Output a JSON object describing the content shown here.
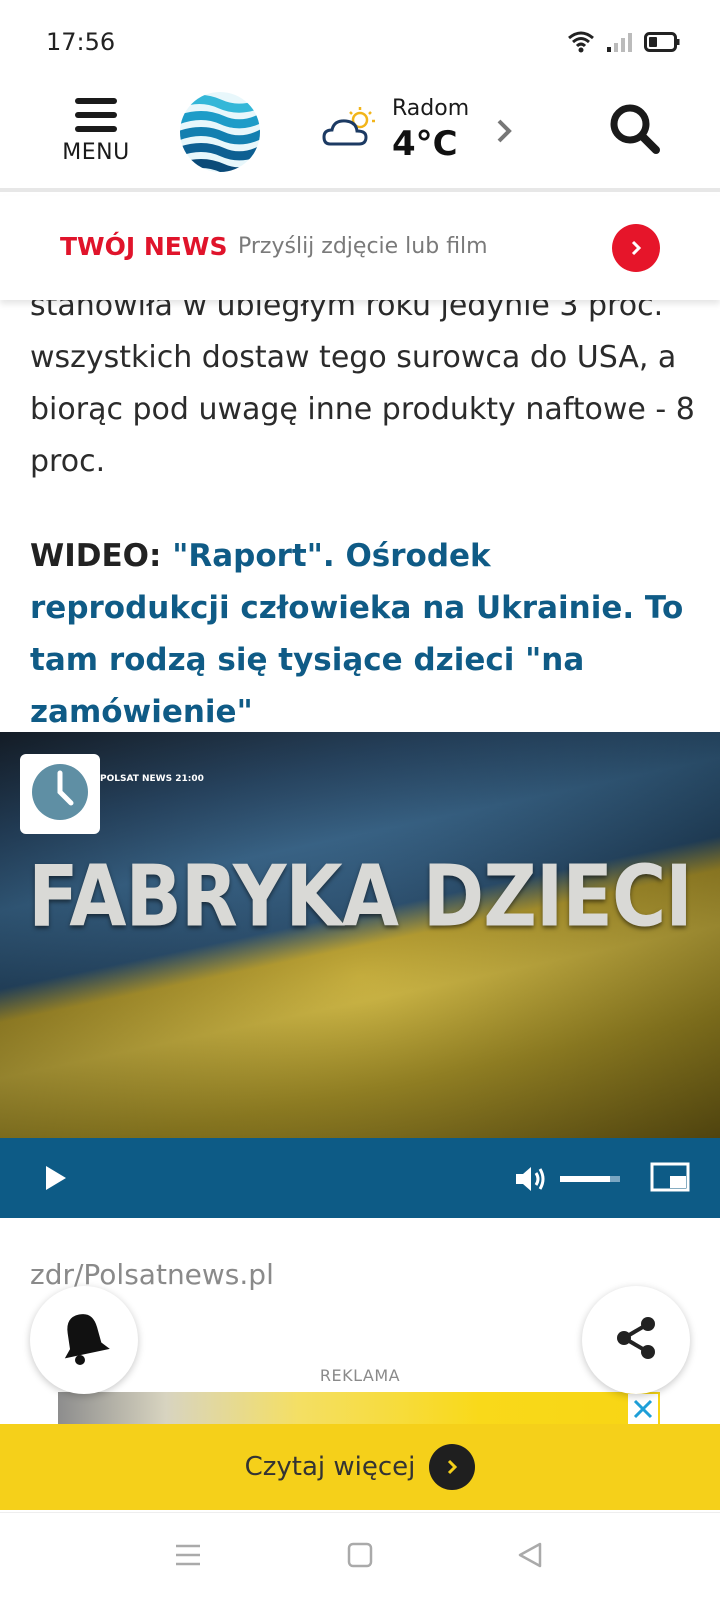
{
  "status_bar": {
    "time": "17:56"
  },
  "header": {
    "menu_label": "MENU",
    "weather_city": "Radom",
    "weather_temp": "4°C"
  },
  "news_banner": {
    "title": "TWÓJ NEWS",
    "subtitle": "Przyślij zdjęcie lub film"
  },
  "article": {
    "paragraph": "stanowiła w ubiegłym roku jedynie 3 proc. wszystkich dostaw tego surowca do USA, a biorąc pod uwagę inne produkty naftowe - 8 proc.",
    "video_prefix": "WIDEO:",
    "video_link": "\"Raport\". Ośrodek reprodukcji człowieka na Ukrainie. To tam rodzą się tysiące dzieci \"na zamówienie\""
  },
  "video": {
    "channel": "POLSAT NEWS 21:00",
    "title": "FABRYKA DZIECI",
    "volume_level": 0.8
  },
  "source": "zdr/Polsatnews.pl",
  "ad": {
    "label": "REKLAMA",
    "read_more": "Czytaj więcej"
  },
  "colors": {
    "brand_blue": "#0d5b86",
    "news_red": "#e0142b",
    "ad_yellow": "#f5d01a"
  },
  "icons": [
    "wifi-icon",
    "signal-icon",
    "battery-icon",
    "menu-icon",
    "logo-icon",
    "partly-cloudy-icon",
    "chevron-right-icon",
    "search-icon",
    "clock-icon",
    "play-icon",
    "volume-icon",
    "fullscreen-icon",
    "bell-icon",
    "share-icon",
    "close-icon",
    "nav-menu-icon",
    "nav-home-icon",
    "nav-back-icon"
  ]
}
